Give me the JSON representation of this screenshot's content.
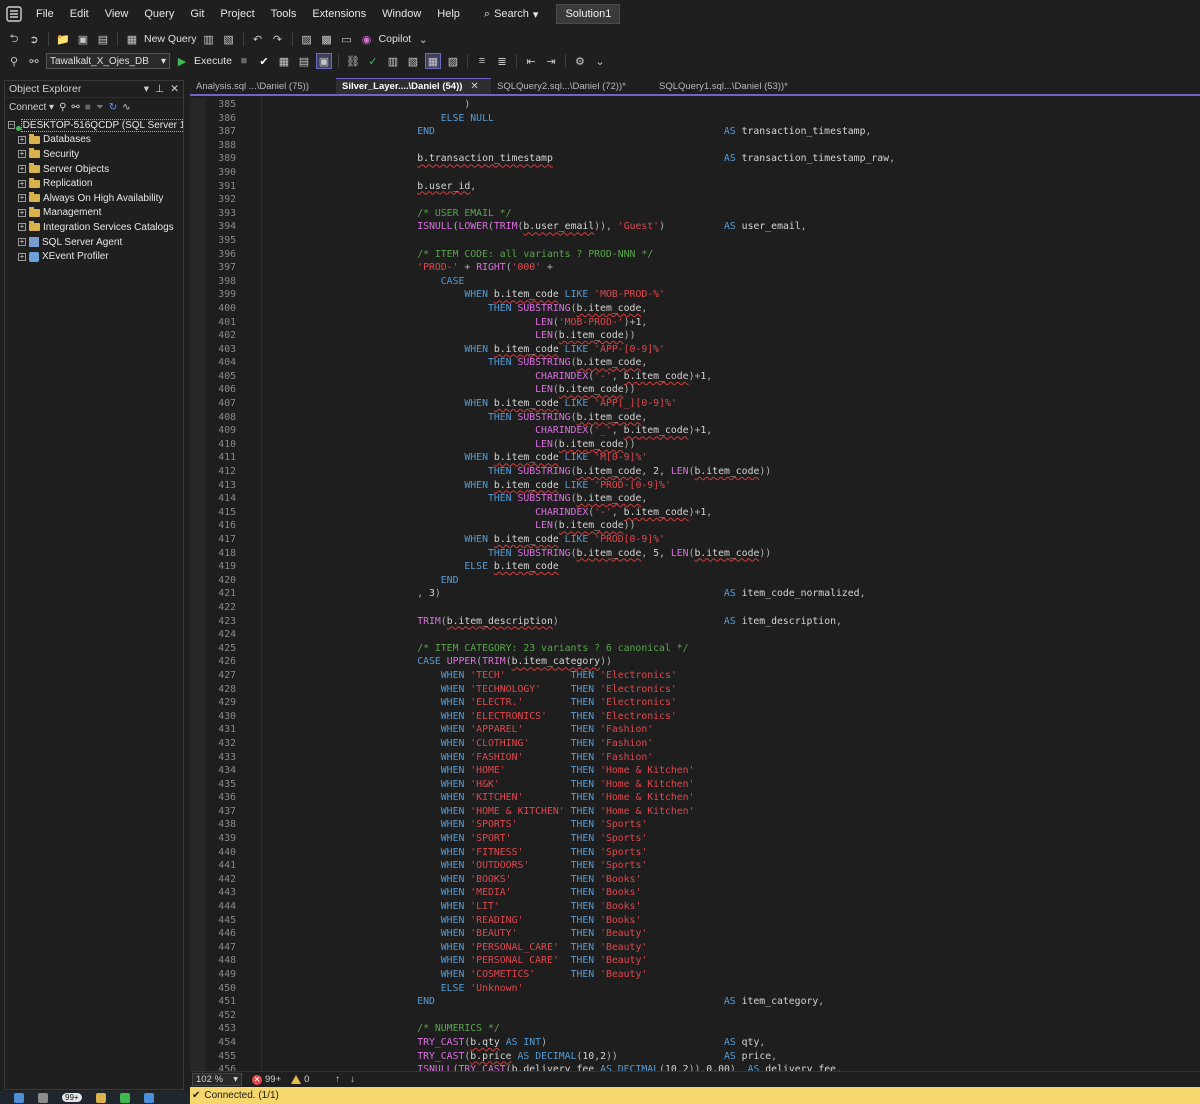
{
  "menu": {
    "items": [
      "File",
      "Edit",
      "View",
      "Query",
      "Git",
      "Project",
      "Tools",
      "Extensions",
      "Window",
      "Help"
    ],
    "search_label": "Search",
    "solution_label": "Solution1"
  },
  "toolbar": {
    "new_query_label": "New Query",
    "copilot_label": "Copilot",
    "database": "Tawalkalt_X_Ojes_DB",
    "execute_label": "Execute"
  },
  "object_explorer": {
    "title": "Object Explorer",
    "connect_label": "Connect",
    "root": "DESKTOP-516QCDP (SQL Server 16.0",
    "nodes": [
      {
        "label": "Databases",
        "icon": "folder-icon"
      },
      {
        "label": "Security",
        "icon": "folder-icon"
      },
      {
        "label": "Server Objects",
        "icon": "folder-icon"
      },
      {
        "label": "Replication",
        "icon": "folder-icon"
      },
      {
        "label": "Always On High Availability",
        "icon": "folder-icon"
      },
      {
        "label": "Management",
        "icon": "folder-icon"
      },
      {
        "label": "Integration Services Catalogs",
        "icon": "folder-icon"
      },
      {
        "label": "SQL Server Agent",
        "icon": "agent-icon"
      },
      {
        "label": "XEvent Profiler",
        "icon": "profiler-icon"
      }
    ]
  },
  "tabs": [
    {
      "label": "Analysis.sql ...\\Daniel (75))",
      "active": false
    },
    {
      "label": "Silver_Layer....\\Daniel (54))",
      "active": true
    },
    {
      "label": "SQLQuery2.sql...\\Daniel (72))*",
      "active": false
    },
    {
      "label": "SQLQuery1.sql...\\Daniel (53))*",
      "active": false
    }
  ],
  "code_lines": [
    {
      "n": "385",
      "t": "                )"
    },
    {
      "n": "386",
      "t": "            ELSE NULL"
    },
    {
      "n": "387",
      "t": "        END                                                 AS transaction_timestamp,"
    },
    {
      "n": "388",
      "t": ""
    },
    {
      "n": "389",
      "t": "        b.transaction_timestamp                             AS transaction_timestamp_raw,"
    },
    {
      "n": "390",
      "t": ""
    },
    {
      "n": "391",
      "t": "        b.user_id,"
    },
    {
      "n": "392",
      "t": ""
    },
    {
      "n": "393",
      "t": "        /* USER EMAIL */"
    },
    {
      "n": "394",
      "t": "        ISNULL(LOWER(TRIM(b.user_email)), 'Guest')          AS user_email,"
    },
    {
      "n": "395",
      "t": ""
    },
    {
      "n": "396",
      "t": "        /* ITEM CODE: all variants ? PROD-NNN */"
    },
    {
      "n": "397",
      "t": "        'PROD-' + RIGHT('000' +"
    },
    {
      "n": "398",
      "t": "            CASE"
    },
    {
      "n": "399",
      "t": "                WHEN b.item_code LIKE 'MOB-PROD-%'"
    },
    {
      "n": "400",
      "t": "                    THEN SUBSTRING(b.item_code,"
    },
    {
      "n": "401",
      "t": "                            LEN('MOB-PROD-')+1,"
    },
    {
      "n": "402",
      "t": "                            LEN(b.item_code))"
    },
    {
      "n": "403",
      "t": "                WHEN b.item_code LIKE 'APP-[0-9]%'"
    },
    {
      "n": "404",
      "t": "                    THEN SUBSTRING(b.item_code,"
    },
    {
      "n": "405",
      "t": "                            CHARINDEX('-', b.item_code)+1,"
    },
    {
      "n": "406",
      "t": "                            LEN(b.item_code))"
    },
    {
      "n": "407",
      "t": "                WHEN b.item_code LIKE 'APP[_][0-9]%'"
    },
    {
      "n": "408",
      "t": "                    THEN SUBSTRING(b.item_code,"
    },
    {
      "n": "409",
      "t": "                            CHARINDEX('_', b.item_code)+1,"
    },
    {
      "n": "410",
      "t": "                            LEN(b.item_code))"
    },
    {
      "n": "411",
      "t": "                WHEN b.item_code LIKE 'M[0-9]%'"
    },
    {
      "n": "412",
      "t": "                    THEN SUBSTRING(b.item_code, 2, LEN(b.item_code))"
    },
    {
      "n": "413",
      "t": "                WHEN b.item_code LIKE 'PROD-[0-9]%'"
    },
    {
      "n": "414",
      "t": "                    THEN SUBSTRING(b.item_code,"
    },
    {
      "n": "415",
      "t": "                            CHARINDEX('-', b.item_code)+1,"
    },
    {
      "n": "416",
      "t": "                            LEN(b.item_code))"
    },
    {
      "n": "417",
      "t": "                WHEN b.item_code LIKE 'PROD[0-9]%'"
    },
    {
      "n": "418",
      "t": "                    THEN SUBSTRING(b.item_code, 5, LEN(b.item_code))"
    },
    {
      "n": "419",
      "t": "                ELSE b.item_code"
    },
    {
      "n": "420",
      "t": "            END"
    },
    {
      "n": "421",
      "t": "        , 3)                                                AS item_code_normalized,"
    },
    {
      "n": "422",
      "t": ""
    },
    {
      "n": "423",
      "t": "        TRIM(b.item_description)                            AS item_description,"
    },
    {
      "n": "424",
      "t": ""
    },
    {
      "n": "425",
      "t": "        /* ITEM CATEGORY: 23 variants ? 6 canonical */"
    },
    {
      "n": "426",
      "t": "        CASE UPPER(TRIM(b.item_category))"
    },
    {
      "n": "427",
      "t": "            WHEN 'TECH'           THEN 'Electronics'"
    },
    {
      "n": "428",
      "t": "            WHEN 'TECHNOLOGY'     THEN 'Electronics'"
    },
    {
      "n": "429",
      "t": "            WHEN 'ELECTR.'        THEN 'Electronics'"
    },
    {
      "n": "430",
      "t": "            WHEN 'ELECTRONICS'    THEN 'Electronics'"
    },
    {
      "n": "431",
      "t": "            WHEN 'APPAREL'        THEN 'Fashion'"
    },
    {
      "n": "432",
      "t": "            WHEN 'CLOTHING'       THEN 'Fashion'"
    },
    {
      "n": "433",
      "t": "            WHEN 'FASHION'        THEN 'Fashion'"
    },
    {
      "n": "434",
      "t": "            WHEN 'HOME'           THEN 'Home & Kitchen'"
    },
    {
      "n": "435",
      "t": "            WHEN 'H&K'            THEN 'Home & Kitchen'"
    },
    {
      "n": "436",
      "t": "            WHEN 'KITCHEN'        THEN 'Home & Kitchen'"
    },
    {
      "n": "437",
      "t": "            WHEN 'HOME & KITCHEN' THEN 'Home & Kitchen'"
    },
    {
      "n": "438",
      "t": "            WHEN 'SPORTS'         THEN 'Sports'"
    },
    {
      "n": "439",
      "t": "            WHEN 'SPORT'          THEN 'Sports'"
    },
    {
      "n": "440",
      "t": "            WHEN 'FITNESS'        THEN 'Sports'"
    },
    {
      "n": "441",
      "t": "            WHEN 'OUTDOORS'       THEN 'Sports'"
    },
    {
      "n": "442",
      "t": "            WHEN 'BOOKS'          THEN 'Books'"
    },
    {
      "n": "443",
      "t": "            WHEN 'MEDIA'          THEN 'Books'"
    },
    {
      "n": "444",
      "t": "            WHEN 'LIT'            THEN 'Books'"
    },
    {
      "n": "445",
      "t": "            WHEN 'READING'        THEN 'Books'"
    },
    {
      "n": "446",
      "t": "            WHEN 'BEAUTY'         THEN 'Beauty'"
    },
    {
      "n": "447",
      "t": "            WHEN 'PERSONAL_CARE'  THEN 'Beauty'"
    },
    {
      "n": "448",
      "t": "            WHEN 'PERSONAL CARE'  THEN 'Beauty'"
    },
    {
      "n": "449",
      "t": "            WHEN 'COSMETICS'      THEN 'Beauty'"
    },
    {
      "n": "450",
      "t": "            ELSE 'Unknown'"
    },
    {
      "n": "451",
      "t": "        END                                                 AS item_category,"
    },
    {
      "n": "452",
      "t": ""
    },
    {
      "n": "453",
      "t": "        /* NUMERICS */"
    },
    {
      "n": "454",
      "t": "        TRY_CAST(b.qty AS INT)                              AS qty,"
    },
    {
      "n": "455",
      "t": "        TRY_CAST(b.price AS DECIMAL(10,2))                  AS price,"
    },
    {
      "n": "456",
      "t": "        ISNULL(TRY_CAST(b.delivery_fee AS DECIMAL(10,2)),0.00)  AS delivery_fee,"
    }
  ],
  "status": {
    "zoom": "102 %",
    "errors": "99+",
    "warnings": "0",
    "connection": "Connected. (1/1)"
  },
  "taskbar": {
    "badge": "99+"
  },
  "colors": {
    "accent": "#7163c8",
    "keyword": "#569cd6",
    "function": "#dc6fe0",
    "string": "#e0474c",
    "comment": "#57a64a",
    "connected_bar": "#f5d76e"
  }
}
